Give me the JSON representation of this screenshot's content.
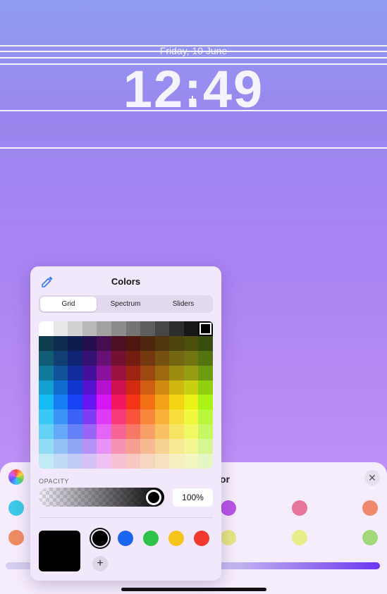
{
  "lock_screen": {
    "date": "Friday, 10 June",
    "time": "12:49"
  },
  "background_sheet": {
    "title_fragment": "or",
    "close_symbol": "✕",
    "swatches": [
      {
        "color": "rainbow",
        "icon": "color-wheel-icon"
      },
      {
        "color": "#3cc8e6"
      },
      {
        "color": "#b855e6"
      },
      {
        "color": "#e6749b"
      },
      {
        "color": "#f0886c"
      },
      {
        "color": "#f08c64"
      },
      {
        "color": "#e6e684"
      },
      {
        "color": "#e6ee8a"
      },
      {
        "color": "#a0d87a"
      }
    ],
    "slider_color_end": "#6a36f0"
  },
  "colors_popover": {
    "title": "Colors",
    "tabs": [
      {
        "label": "Grid",
        "active": true
      },
      {
        "label": "Spectrum",
        "active": false
      },
      {
        "label": "Sliders",
        "active": false
      }
    ],
    "grid_selected": {
      "row": 0,
      "col": 11
    },
    "opacity": {
      "label": "OPACITY",
      "value": "100%",
      "level": 1.0
    },
    "current_color": "#000000",
    "favorites": [
      {
        "color": "#000000",
        "selected": true
      },
      {
        "color": "#1a66f0",
        "selected": false
      },
      {
        "color": "#2fc24a",
        "selected": false
      },
      {
        "color": "#f7c51a",
        "selected": false
      },
      {
        "color": "#f23a2f",
        "selected": false
      }
    ],
    "add_symbol": "+"
  }
}
